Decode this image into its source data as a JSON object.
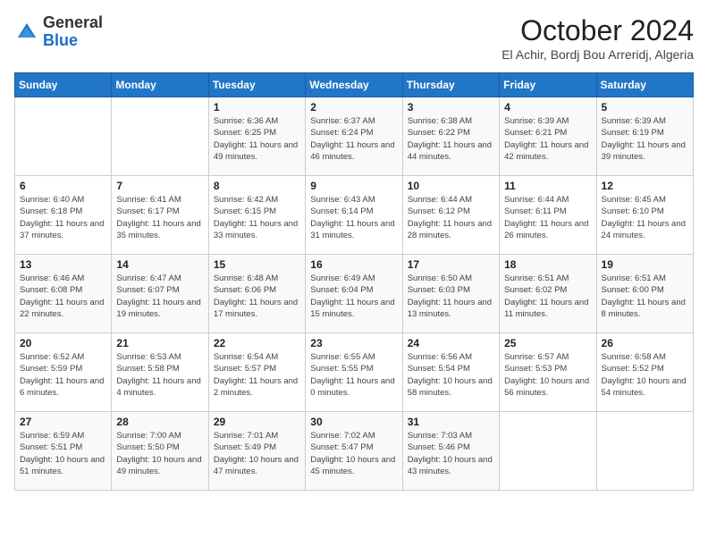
{
  "header": {
    "logo_general": "General",
    "logo_blue": "Blue",
    "month": "October 2024",
    "location": "El Achir, Bordj Bou Arreridj, Algeria"
  },
  "days_of_week": [
    "Sunday",
    "Monday",
    "Tuesday",
    "Wednesday",
    "Thursday",
    "Friday",
    "Saturday"
  ],
  "weeks": [
    [
      {
        "day": "",
        "info": ""
      },
      {
        "day": "",
        "info": ""
      },
      {
        "day": "1",
        "info": "Sunrise: 6:36 AM\nSunset: 6:25 PM\nDaylight: 11 hours and 49 minutes."
      },
      {
        "day": "2",
        "info": "Sunrise: 6:37 AM\nSunset: 6:24 PM\nDaylight: 11 hours and 46 minutes."
      },
      {
        "day": "3",
        "info": "Sunrise: 6:38 AM\nSunset: 6:22 PM\nDaylight: 11 hours and 44 minutes."
      },
      {
        "day": "4",
        "info": "Sunrise: 6:39 AM\nSunset: 6:21 PM\nDaylight: 11 hours and 42 minutes."
      },
      {
        "day": "5",
        "info": "Sunrise: 6:39 AM\nSunset: 6:19 PM\nDaylight: 11 hours and 39 minutes."
      }
    ],
    [
      {
        "day": "6",
        "info": "Sunrise: 6:40 AM\nSunset: 6:18 PM\nDaylight: 11 hours and 37 minutes."
      },
      {
        "day": "7",
        "info": "Sunrise: 6:41 AM\nSunset: 6:17 PM\nDaylight: 11 hours and 35 minutes."
      },
      {
        "day": "8",
        "info": "Sunrise: 6:42 AM\nSunset: 6:15 PM\nDaylight: 11 hours and 33 minutes."
      },
      {
        "day": "9",
        "info": "Sunrise: 6:43 AM\nSunset: 6:14 PM\nDaylight: 11 hours and 31 minutes."
      },
      {
        "day": "10",
        "info": "Sunrise: 6:44 AM\nSunset: 6:12 PM\nDaylight: 11 hours and 28 minutes."
      },
      {
        "day": "11",
        "info": "Sunrise: 6:44 AM\nSunset: 6:11 PM\nDaylight: 11 hours and 26 minutes."
      },
      {
        "day": "12",
        "info": "Sunrise: 6:45 AM\nSunset: 6:10 PM\nDaylight: 11 hours and 24 minutes."
      }
    ],
    [
      {
        "day": "13",
        "info": "Sunrise: 6:46 AM\nSunset: 6:08 PM\nDaylight: 11 hours and 22 minutes."
      },
      {
        "day": "14",
        "info": "Sunrise: 6:47 AM\nSunset: 6:07 PM\nDaylight: 11 hours and 19 minutes."
      },
      {
        "day": "15",
        "info": "Sunrise: 6:48 AM\nSunset: 6:06 PM\nDaylight: 11 hours and 17 minutes."
      },
      {
        "day": "16",
        "info": "Sunrise: 6:49 AM\nSunset: 6:04 PM\nDaylight: 11 hours and 15 minutes."
      },
      {
        "day": "17",
        "info": "Sunrise: 6:50 AM\nSunset: 6:03 PM\nDaylight: 11 hours and 13 minutes."
      },
      {
        "day": "18",
        "info": "Sunrise: 6:51 AM\nSunset: 6:02 PM\nDaylight: 11 hours and 11 minutes."
      },
      {
        "day": "19",
        "info": "Sunrise: 6:51 AM\nSunset: 6:00 PM\nDaylight: 11 hours and 8 minutes."
      }
    ],
    [
      {
        "day": "20",
        "info": "Sunrise: 6:52 AM\nSunset: 5:59 PM\nDaylight: 11 hours and 6 minutes."
      },
      {
        "day": "21",
        "info": "Sunrise: 6:53 AM\nSunset: 5:58 PM\nDaylight: 11 hours and 4 minutes."
      },
      {
        "day": "22",
        "info": "Sunrise: 6:54 AM\nSunset: 5:57 PM\nDaylight: 11 hours and 2 minutes."
      },
      {
        "day": "23",
        "info": "Sunrise: 6:55 AM\nSunset: 5:55 PM\nDaylight: 11 hours and 0 minutes."
      },
      {
        "day": "24",
        "info": "Sunrise: 6:56 AM\nSunset: 5:54 PM\nDaylight: 10 hours and 58 minutes."
      },
      {
        "day": "25",
        "info": "Sunrise: 6:57 AM\nSunset: 5:53 PM\nDaylight: 10 hours and 56 minutes."
      },
      {
        "day": "26",
        "info": "Sunrise: 6:58 AM\nSunset: 5:52 PM\nDaylight: 10 hours and 54 minutes."
      }
    ],
    [
      {
        "day": "27",
        "info": "Sunrise: 6:59 AM\nSunset: 5:51 PM\nDaylight: 10 hours and 51 minutes."
      },
      {
        "day": "28",
        "info": "Sunrise: 7:00 AM\nSunset: 5:50 PM\nDaylight: 10 hours and 49 minutes."
      },
      {
        "day": "29",
        "info": "Sunrise: 7:01 AM\nSunset: 5:49 PM\nDaylight: 10 hours and 47 minutes."
      },
      {
        "day": "30",
        "info": "Sunrise: 7:02 AM\nSunset: 5:47 PM\nDaylight: 10 hours and 45 minutes."
      },
      {
        "day": "31",
        "info": "Sunrise: 7:03 AM\nSunset: 5:46 PM\nDaylight: 10 hours and 43 minutes."
      },
      {
        "day": "",
        "info": ""
      },
      {
        "day": "",
        "info": ""
      }
    ]
  ]
}
